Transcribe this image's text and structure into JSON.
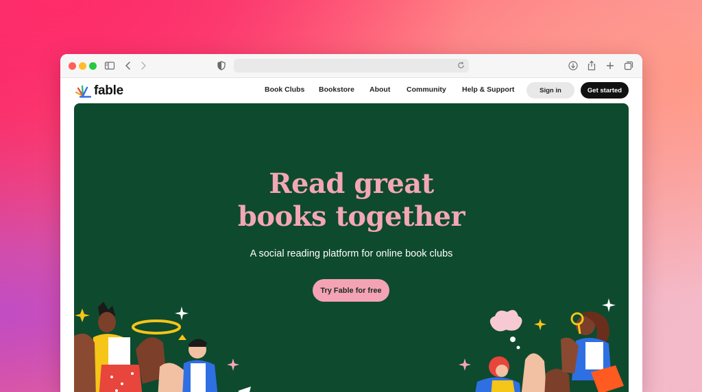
{
  "browser": {
    "url_text": ""
  },
  "site": {
    "logo_text": "fable"
  },
  "nav": {
    "links": [
      {
        "label": "Book Clubs"
      },
      {
        "label": "Bookstore"
      },
      {
        "label": "About"
      },
      {
        "label": "Community"
      },
      {
        "label": "Help & Support"
      }
    ],
    "signin_label": "Sign in",
    "get_started_label": "Get started"
  },
  "hero": {
    "title_line1": "Read great",
    "title_line2": "books together",
    "subtitle": "A social reading platform for online book clubs",
    "cta_label": "Try Fable for free"
  },
  "colors": {
    "hero_bg": "#0e4a2e",
    "title_pink": "#f3a7b5",
    "cta_pink": "#f4a3b4"
  }
}
